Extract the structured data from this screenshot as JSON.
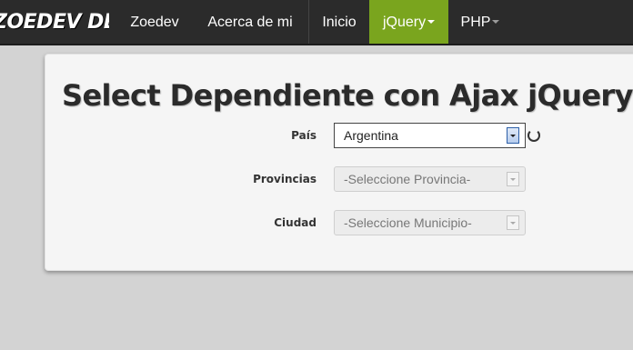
{
  "navbar": {
    "brand": "ZOEDEV DEMOS",
    "items": [
      {
        "label": "Zoedev"
      },
      {
        "label": "Acerca de mi"
      },
      {
        "label": "Inicio"
      },
      {
        "label": "jQuery",
        "active": true,
        "dropdown": true
      },
      {
        "label": "PHP",
        "dropdown": true
      }
    ],
    "active_color": "#7aa51e"
  },
  "main": {
    "title": "Select Dependiente con Ajax jQuery",
    "fields": [
      {
        "label": "País",
        "value": "Argentina",
        "enabled": true
      },
      {
        "label": "Provincias",
        "value": "-Seleccione Provincia-",
        "enabled": false
      },
      {
        "label": "Ciudad",
        "value": "-Seleccione Municipio-",
        "enabled": false
      }
    ],
    "loading_icon": "spinner-icon"
  }
}
